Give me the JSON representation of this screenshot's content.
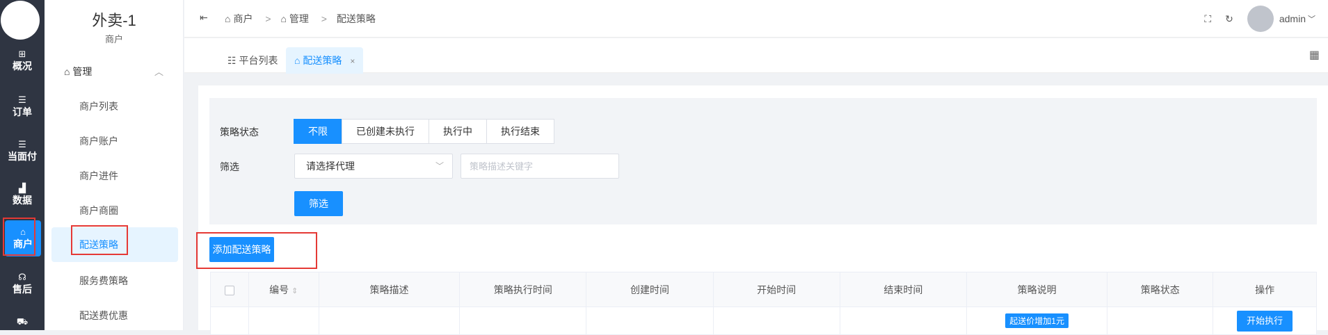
{
  "rail": {
    "items": [
      {
        "label": "概况",
        "icon": "dashboard-icon",
        "glyph": "⊞"
      },
      {
        "label": "订单",
        "icon": "list-icon",
        "glyph": "☰"
      },
      {
        "label": "当面付",
        "icon": "list-icon",
        "glyph": "☰"
      },
      {
        "label": "数据",
        "icon": "bar-chart-icon",
        "glyph": "▟"
      },
      {
        "label": "商户",
        "icon": "store-icon",
        "glyph": "⌂"
      },
      {
        "label": "售后",
        "icon": "headset-icon",
        "glyph": "☊"
      },
      {
        "label": "",
        "icon": "truck-icon",
        "glyph": "⛟"
      }
    ],
    "active_color": "#1890ff"
  },
  "sidebar": {
    "brand": "外卖-1",
    "subtitle": "商户",
    "group": "管理",
    "items": [
      "商户列表",
      "商户账户",
      "商户进件",
      "商户商圈",
      "配送策略",
      "服务费策略",
      "配送费优惠"
    ]
  },
  "topbar": {
    "breadcrumb": [
      "商户",
      "管理",
      "配送策略"
    ],
    "user": "admin"
  },
  "tabs": [
    "平台列表",
    "配送策略"
  ],
  "filter": {
    "status_label": "策略状态",
    "status_options": [
      "不限",
      "已创建未执行",
      "执行中",
      "执行结束"
    ],
    "filter_label": "筛选",
    "agent_select": "请选择代理",
    "keyword_placeholder": "策略描述关键字",
    "filter_button": "筛选"
  },
  "add_button": "添加配送策略",
  "table": {
    "headers": [
      "编号",
      "策略描述",
      "策略执行时间",
      "创建时间",
      "开始时间",
      "结束时间",
      "策略说明",
      "策略状态",
      "操作"
    ],
    "row": {
      "tag": "起送价增加1元",
      "action": "开始执行"
    }
  },
  "colors": {
    "primary": "#1890ff",
    "highlight": "#e53935",
    "rail": "#2f3542"
  }
}
